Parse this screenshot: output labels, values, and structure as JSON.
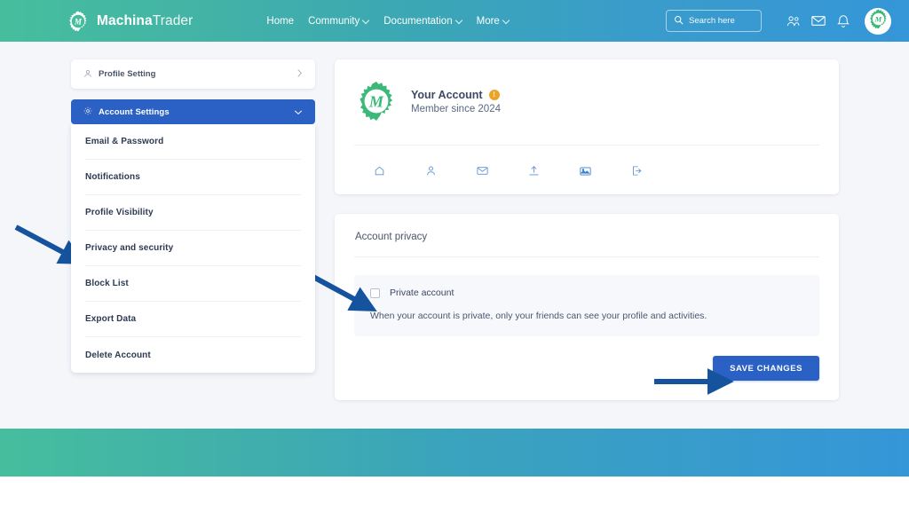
{
  "navbar": {
    "brand_bold": "Machina",
    "brand_light": "Trader",
    "brand_logo_icon": "machinatrader-gear-logo",
    "links": [
      {
        "label": "Home",
        "has_caret": false
      },
      {
        "label": "Community",
        "has_caret": true
      },
      {
        "label": "Documentation",
        "has_caret": true
      },
      {
        "label": "More",
        "has_caret": true
      }
    ],
    "search": {
      "placeholder": "Search here",
      "icon": "search-icon"
    },
    "icons": [
      {
        "name": "people-icon"
      },
      {
        "name": "envelope-icon"
      },
      {
        "name": "bell-icon"
      }
    ],
    "avatar_icon": "user-avatar-gear-logo",
    "gradient_start": "#46be9e",
    "gradient_end": "#3596d8"
  },
  "sidebar": {
    "profile_setting": {
      "label": "Profile Setting",
      "icon": "user-icon",
      "chevron": "chevron-right-icon"
    },
    "account_settings": {
      "label": "Account Settings",
      "icon": "gear-icon",
      "chevron": "chevron-down-icon",
      "active_color": "#2b61c4"
    },
    "submenu": [
      {
        "label": "Email & Password"
      },
      {
        "label": "Notifications"
      },
      {
        "label": "Profile Visibility"
      },
      {
        "label": "Privacy and security"
      },
      {
        "label": "Block List"
      },
      {
        "label": "Export Data"
      },
      {
        "label": "Delete Account"
      }
    ]
  },
  "account_card": {
    "logo_icon": "machinatrader-gear-logo",
    "name": "Your Account",
    "badge": "!",
    "badge_color": "#eda426",
    "member_since": "Member since 2024",
    "action_icons": [
      {
        "name": "home-icon"
      },
      {
        "name": "person-icon"
      },
      {
        "name": "envelope-icon"
      },
      {
        "name": "upload-icon"
      },
      {
        "name": "image-icon"
      },
      {
        "name": "logout-icon"
      }
    ]
  },
  "privacy": {
    "title": "Account privacy",
    "checkbox_label": "Private account",
    "checkbox_checked": false,
    "description": "When your account is private, only your friends can see your profile and activities.",
    "save_label": "SAVE CHANGES",
    "save_color": "#2b61c4"
  },
  "annotations": {
    "arrow_color": "#15539e",
    "arrows": [
      {
        "name": "arrow-to-privacy-and-security"
      },
      {
        "name": "arrow-to-private-account-checkbox"
      },
      {
        "name": "arrow-to-save-changes-button"
      }
    ]
  }
}
